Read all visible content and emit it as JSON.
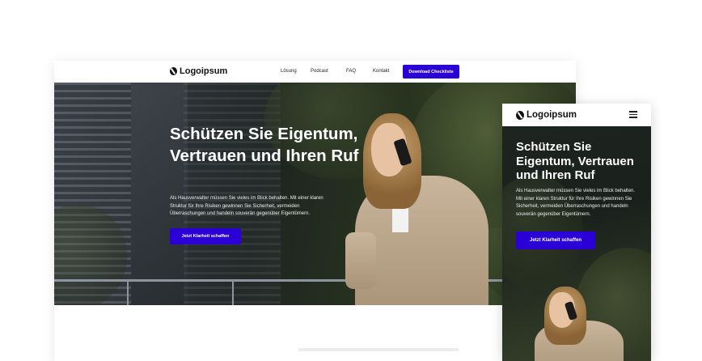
{
  "brand": {
    "logo_text": "Logoipsum",
    "accent": "#2a00d6"
  },
  "desktop": {
    "nav": {
      "links": [
        "Lösung",
        "Podcast",
        "FAQ",
        "Kontakt"
      ],
      "cta": "Download Checkliste"
    },
    "hero": {
      "headline": "Schützen Sie Eigentum, Vertrauen und Ihren Ruf",
      "body": "Als Hausverwalter müssen Sie vieles im Blick behalten. Mit einer klaren Struktur für Ihre Risiken gewinnen Sie Sicherheit, vermeiden Überraschungen und handeln souverän gegenüber Eigentümern.",
      "button": "Jetzt Klarheit schaffen"
    }
  },
  "mobile": {
    "nav": {
      "menu_icon": "hamburger-icon"
    },
    "hero": {
      "headline": "Schützen Sie Eigentum, Vertrauen und Ihren Ruf",
      "body": "Als Hausverwalter müssen Sie vieles im Blick behalten. Mit einer klaren Struktur für Ihre Risiken gewinnen Sie Sicherheit, vermeiden Überraschungen und handeln souverän gegenüber Eigentümern.",
      "button": "Jetzt Klarheit schaffen"
    }
  }
}
